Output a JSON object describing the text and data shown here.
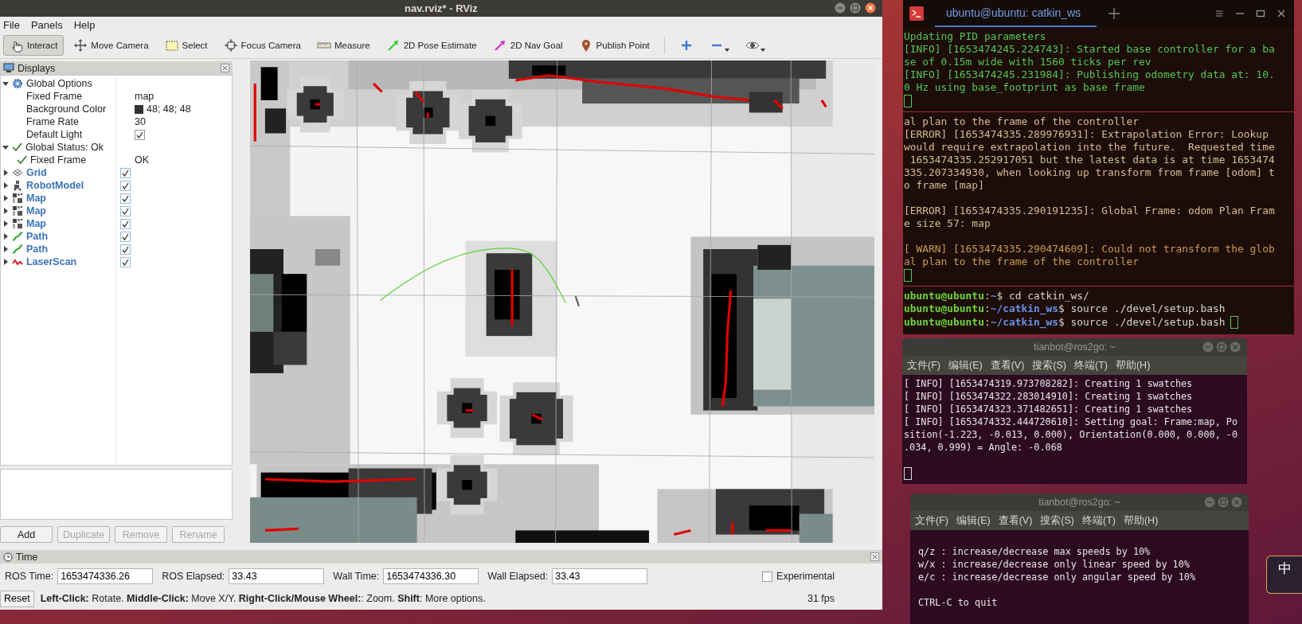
{
  "rviz": {
    "title": "nav.rviz* - RViz",
    "menu": [
      "File",
      "Panels",
      "Help"
    ],
    "tools": [
      {
        "kind": "interact",
        "label": "Interact",
        "selected": true
      },
      {
        "kind": "move",
        "label": "Move Camera",
        "selected": false
      },
      {
        "kind": "select",
        "label": "Select",
        "selected": false
      },
      {
        "kind": "focus",
        "label": "Focus Camera",
        "selected": false
      },
      {
        "kind": "measure",
        "label": "Measure",
        "selected": false
      },
      {
        "kind": "pose",
        "label": "2D Pose Estimate",
        "selected": false
      },
      {
        "kind": "goal",
        "label": "2D Nav Goal",
        "selected": false
      },
      {
        "kind": "point",
        "label": "Publish Point",
        "selected": false
      },
      {
        "kind": "plus",
        "selected": false
      },
      {
        "kind": "minus",
        "selected": false
      },
      {
        "kind": "eye",
        "selected": false
      }
    ],
    "displays": {
      "title": "Displays",
      "tree": [
        {
          "kind": "options",
          "label": "Global Options",
          "expanded": true,
          "children": [
            {
              "kind": "property",
              "label": "Fixed Frame",
              "value": "map"
            },
            {
              "kind": "property",
              "label": "Background Color",
              "value": "48; 48; 48",
              "color": "#303030"
            },
            {
              "kind": "property",
              "label": "Frame Rate",
              "value": "30"
            },
            {
              "kind": "property",
              "label": "Default Light",
              "checked": true
            }
          ]
        },
        {
          "kind": "status",
          "label": "Global Status: Ok",
          "expanded": true,
          "children": [
            {
              "kind": "status",
              "label": "Fixed Frame",
              "value": "OK"
            }
          ]
        },
        {
          "kind": "grid",
          "label": "Grid",
          "expanded": false,
          "checked": true
        },
        {
          "kind": "robot",
          "label": "RobotModel",
          "expanded": false,
          "checked": true
        },
        {
          "kind": "map",
          "label": "Map",
          "expanded": false,
          "checked": true
        },
        {
          "kind": "map",
          "label": "Map",
          "expanded": false,
          "checked": true
        },
        {
          "kind": "map",
          "label": "Map",
          "expanded": false,
          "checked": true
        },
        {
          "kind": "path",
          "label": "Path",
          "expanded": false,
          "checked": true
        },
        {
          "kind": "path",
          "label": "Path",
          "expanded": false,
          "checked": true
        },
        {
          "kind": "laser",
          "label": "LaserScan",
          "expanded": false,
          "checked": true
        }
      ],
      "buttons": [
        {
          "label": "Add",
          "disabled": false
        },
        {
          "label": "Duplicate",
          "disabled": true
        },
        {
          "label": "Remove",
          "disabled": true
        },
        {
          "label": "Rename",
          "disabled": true
        }
      ]
    },
    "time": {
      "title": "Time",
      "fields": [
        {
          "label": "ROS Time:",
          "value": "1653474336.26"
        },
        {
          "label": "ROS Elapsed:",
          "value": "33.43"
        },
        {
          "label": "Wall Time:",
          "value": "1653474336.30"
        },
        {
          "label": "Wall Elapsed:",
          "value": "33.43"
        }
      ],
      "experimental": {
        "label": "Experimental",
        "checked": false
      }
    },
    "status": {
      "reset": "Reset",
      "hint": "**Left-Click:** Rotate. **Middle-Click:** Move X/Y. **Right-Click/Mouse Wheel:**: Zoom. **Shift**: More options.",
      "fps": "31 fps"
    }
  },
  "terminal": {
    "tab": "ubuntu@ubuntu: catkin_ws",
    "panes": [
      {
        "cursor": true,
        "lines": [
          {
            "kind": "info",
            "text": "Updating PID parameters"
          },
          {
            "kind": "info",
            "text": "[INFO] [1653474245.224743]: Started base controller for a ba"
          },
          {
            "kind": "info",
            "text": "se of 0.15m wide with 1560 ticks per rev"
          },
          {
            "kind": "info",
            "text": "[INFO] [1653474245.231984]: Publishing odometry data at: 10."
          },
          {
            "kind": "info",
            "text": "0 Hz using base_footprint as base frame"
          }
        ]
      },
      {
        "cursor": true,
        "lines": [
          {
            "kind": "error",
            "text": "al plan to the frame of the controller"
          },
          {
            "kind": "error",
            "text": "[ERROR] [1653474335.289976931]: Extrapolation Error: Lookup"
          },
          {
            "kind": "error",
            "text": "would require extrapolation into the future.  Requested time"
          },
          {
            "kind": "error",
            "text": " 1653474335.252917051 but the latest data is at time 1653474"
          },
          {
            "kind": "error",
            "text": "335.207334930, when looking up transform from frame [odom] t"
          },
          {
            "kind": "error",
            "text": "o frame [map]"
          },
          {
            "kind": "error",
            "text": "[ERROR] [1653474335.290191235]: Global Frame: odom Plan Fram",
            "blank_before": true
          },
          {
            "kind": "error",
            "text": "e size 57: map"
          },
          {
            "kind": "warn",
            "text": "[ WARN] [1653474335.290474609]: Could not transform the glob",
            "blank_before": true
          },
          {
            "kind": "warn",
            "text": "al plan to the frame of the controller"
          }
        ]
      },
      {
        "cursor": false,
        "lines": [
          {
            "kind": "prompt",
            "parts": [
              {
                "kind": "user",
                "text": "ubuntu@ubuntu"
              },
              {
                "kind": "plain",
                "text": ":"
              },
              {
                "kind": "path",
                "text": "~"
              },
              {
                "kind": "plain",
                "text": "$ cd catkin_ws/"
              }
            ]
          },
          {
            "kind": "prompt",
            "parts": [
              {
                "kind": "user",
                "text": "ubuntu@ubuntu"
              },
              {
                "kind": "plain",
                "text": ":"
              },
              {
                "kind": "path",
                "text": "~/catkin_ws"
              },
              {
                "kind": "plain",
                "text": "$ source ./devel/setup.bash"
              }
            ]
          },
          {
            "kind": "prompt",
            "cursor": true,
            "parts": [
              {
                "kind": "user",
                "text": "ubuntu@ubuntu"
              },
              {
                "kind": "plain",
                "text": ":"
              },
              {
                "kind": "path",
                "text": "~/catkin_ws"
              },
              {
                "kind": "plain",
                "text": "$ source ./devel/setup.bash"
              }
            ]
          }
        ]
      }
    ]
  },
  "consoles": [
    {
      "title": "tianbot@ros2go: ~",
      "menu": [
        "文件(F)",
        "编辑(E)",
        "查看(V)",
        "搜索(S)",
        "终端(T)",
        "帮助(H)"
      ],
      "cursor": true,
      "lines": [
        {
          "text": "[ INFO] [1653474319.973708282]: Creating 1 swatches"
        },
        {
          "text": "[ INFO] [1653474322.283014910]: Creating 1 swatches"
        },
        {
          "text": "[ INFO] [1653474323.371482651]: Creating 1 swatches"
        },
        {
          "text": "[ INFO] [1653474332.444720610]: Setting goal: Frame:map, Po"
        },
        {
          "text": "sition(-1.223, -0.013, 0.000), Orientation(0.000, 0.000, -0"
        },
        {
          "text": ".034, 0.999) = Angle: -0.068"
        }
      ]
    },
    {
      "title": "tianbot@ros2go: ~",
      "menu": [
        "文件(F)",
        "编辑(E)",
        "查看(V)",
        "搜索(S)",
        "终端(T)",
        "帮助(H)"
      ],
      "cursor": false,
      "lines": [
        {
          "text": "q/z : increase/decrease max speeds by 10%",
          "blank_before": true
        },
        {
          "text": "w/x : increase/decrease only linear speed by 10%"
        },
        {
          "text": "e/c : increase/decrease only angular speed by 10%"
        },
        {
          "text": "CTRL-C to quit",
          "blank_before": true
        }
      ]
    }
  ],
  "ime": {
    "label": "中"
  }
}
